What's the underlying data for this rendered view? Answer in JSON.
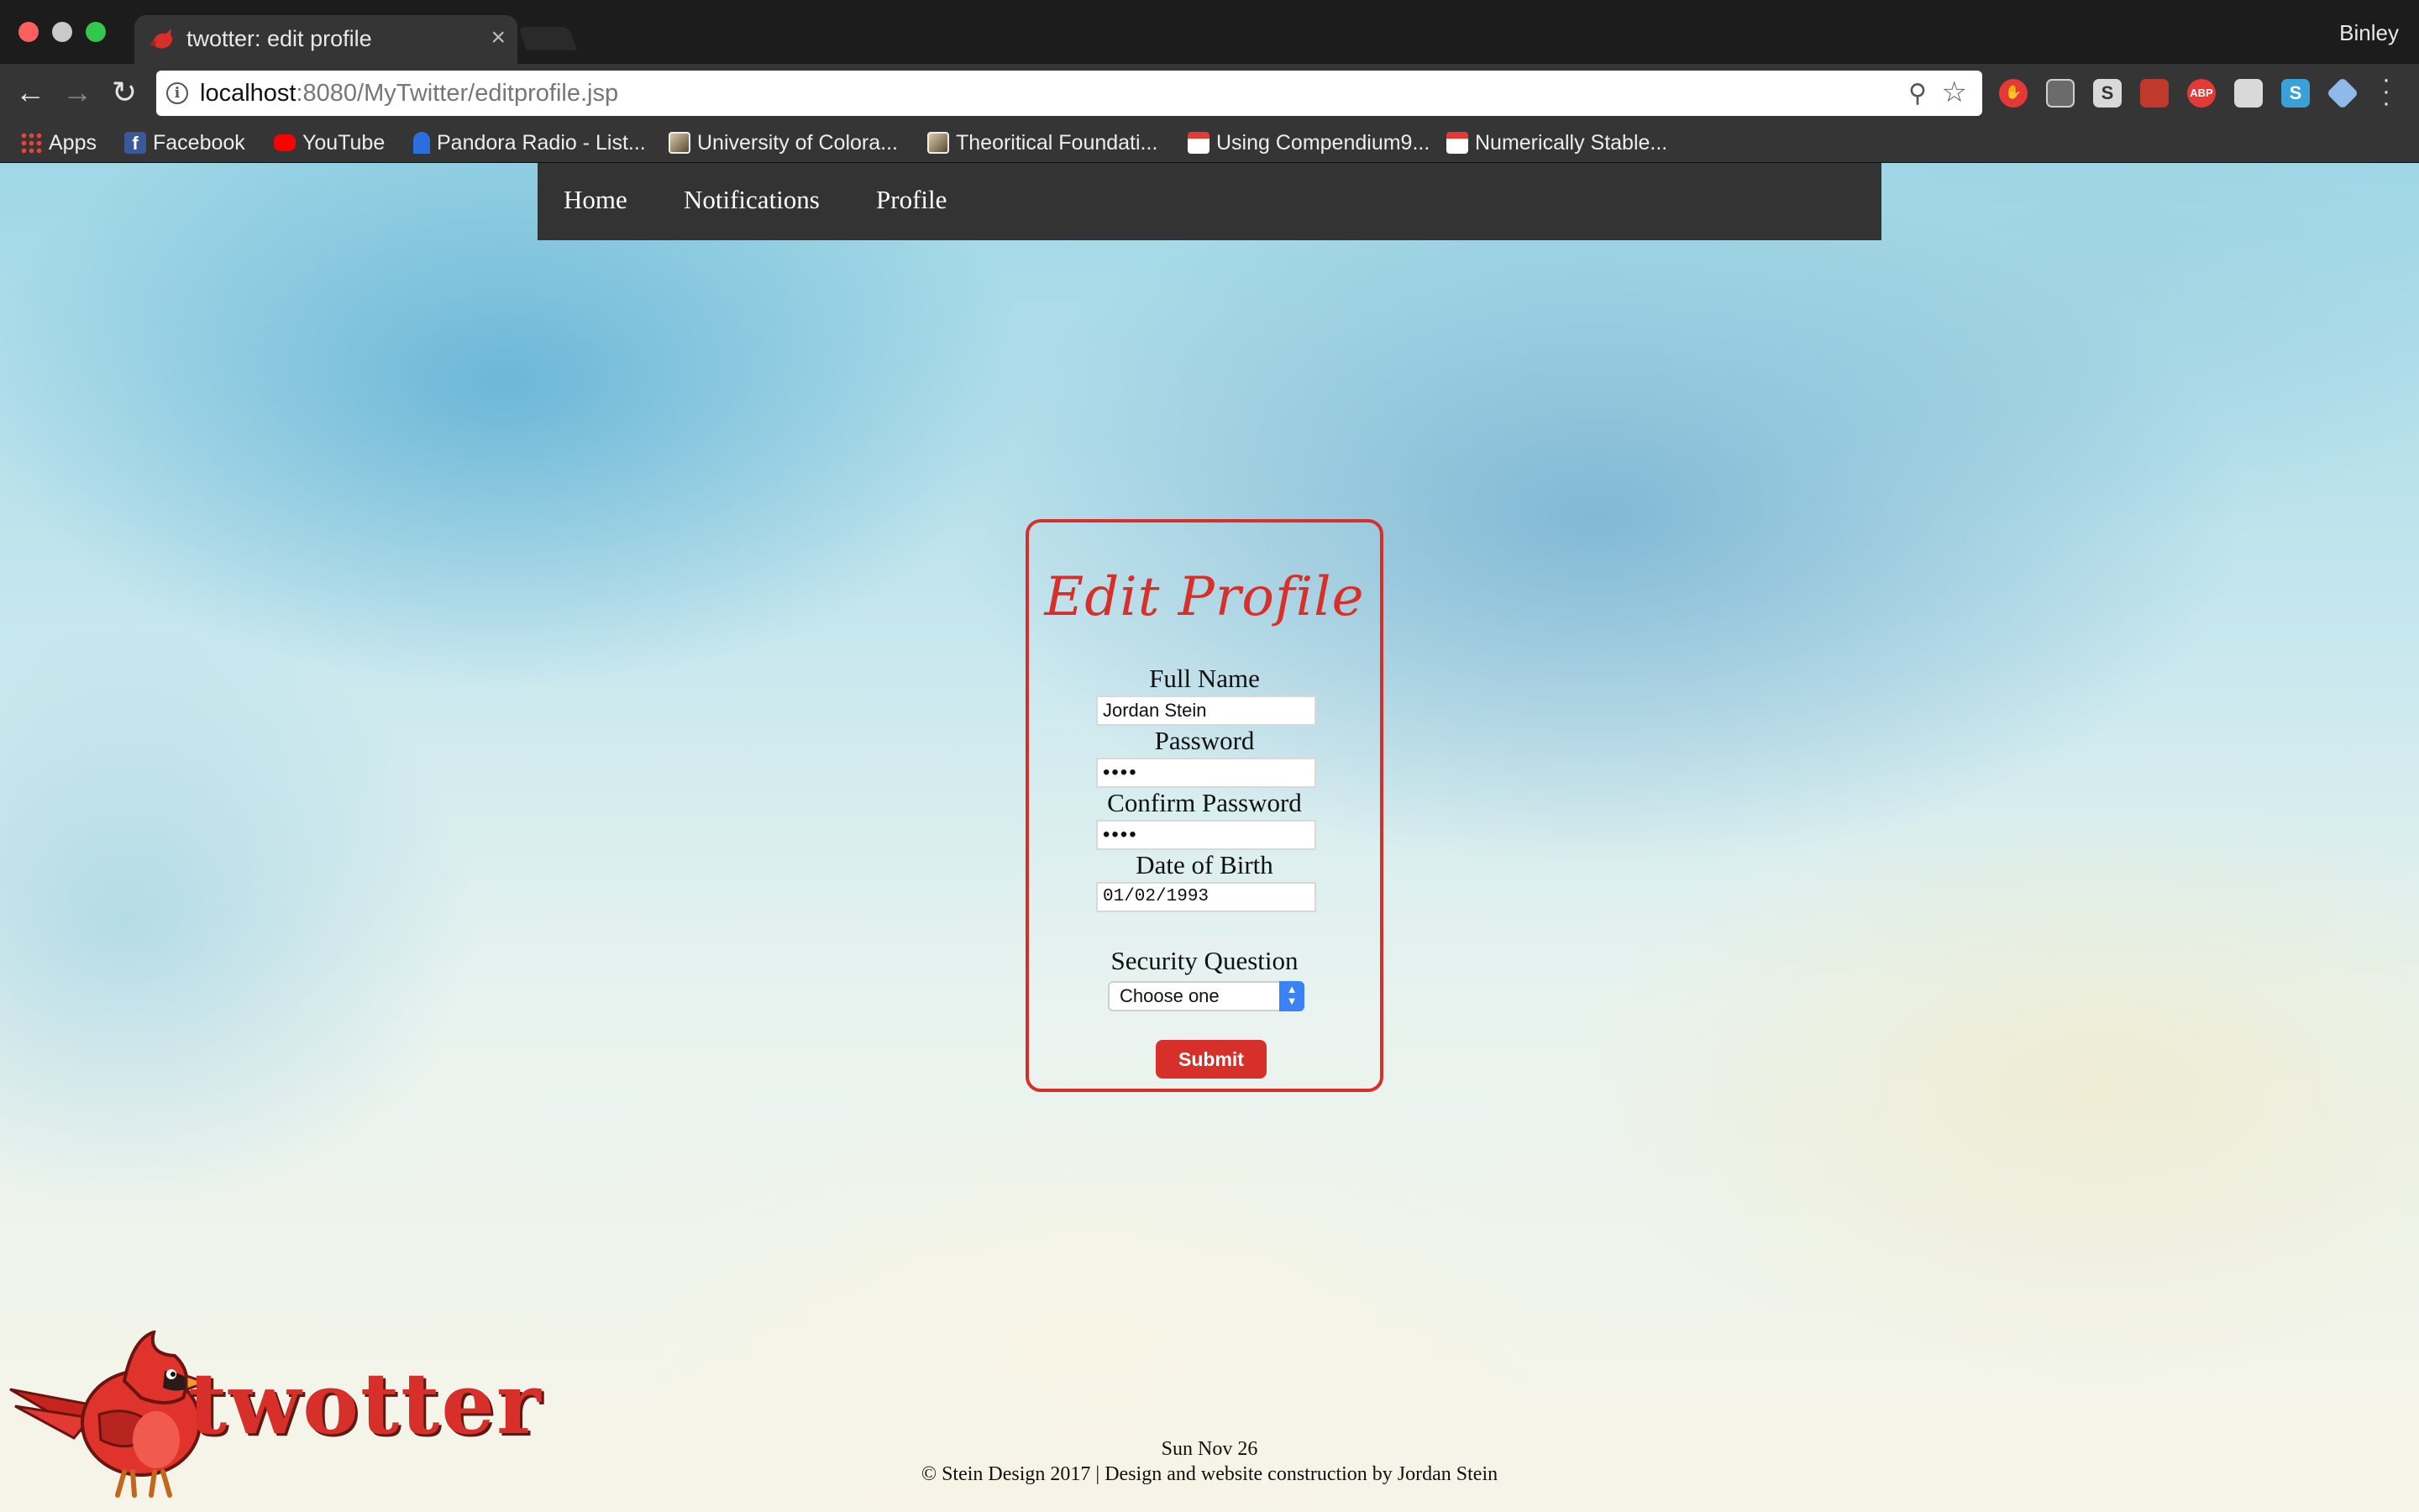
{
  "browser": {
    "tab_title": "twotter: edit profile",
    "tab_close": "×",
    "profile_name": "Binley",
    "url_host": "localhost",
    "url_path": ":8080/MyTwitter/editprofile.jsp",
    "extensions": [
      "stop-icon",
      "reader-icon",
      "S",
      "tape-icon",
      "ABP",
      "cat-icon",
      "S",
      "cube-icon"
    ],
    "bookmarks": [
      {
        "label": "Apps",
        "icon": "apps-grid-icon"
      },
      {
        "label": "Facebook",
        "icon": "facebook-icon"
      },
      {
        "label": "YouTube",
        "icon": "youtube-icon"
      },
      {
        "label": "Pandora Radio - List...",
        "icon": "pandora-icon"
      },
      {
        "label": "University of Colora...",
        "icon": "photo-icon"
      },
      {
        "label": "Theoritical Foundati...",
        "icon": "photo-icon"
      },
      {
        "label": "Using Compendium9...",
        "icon": "pdf-icon"
      },
      {
        "label": "Numerically Stable...",
        "icon": "pdf-icon"
      }
    ]
  },
  "nav": {
    "home": "Home",
    "notifications": "Notifications",
    "profile": "Profile"
  },
  "form": {
    "title": "Edit Profile",
    "full_name_label": "Full Name",
    "full_name_value": "Jordan Stein",
    "password_label": "Password",
    "password_value": "••••",
    "confirm_label": "Confirm Password",
    "confirm_value": "••••",
    "dob_label": "Date of Birth",
    "dob_value": "01/02/1993",
    "security_label": "Security Question",
    "security_selected": "Choose one",
    "submit_label": "Submit"
  },
  "brand": {
    "logo_text": "twotter",
    "accent_color": "#d7302a"
  },
  "footer": {
    "date": "Sun Nov 26",
    "copyright": "© Stein Design 2017 | Design and website construction by Jordan Stein"
  }
}
